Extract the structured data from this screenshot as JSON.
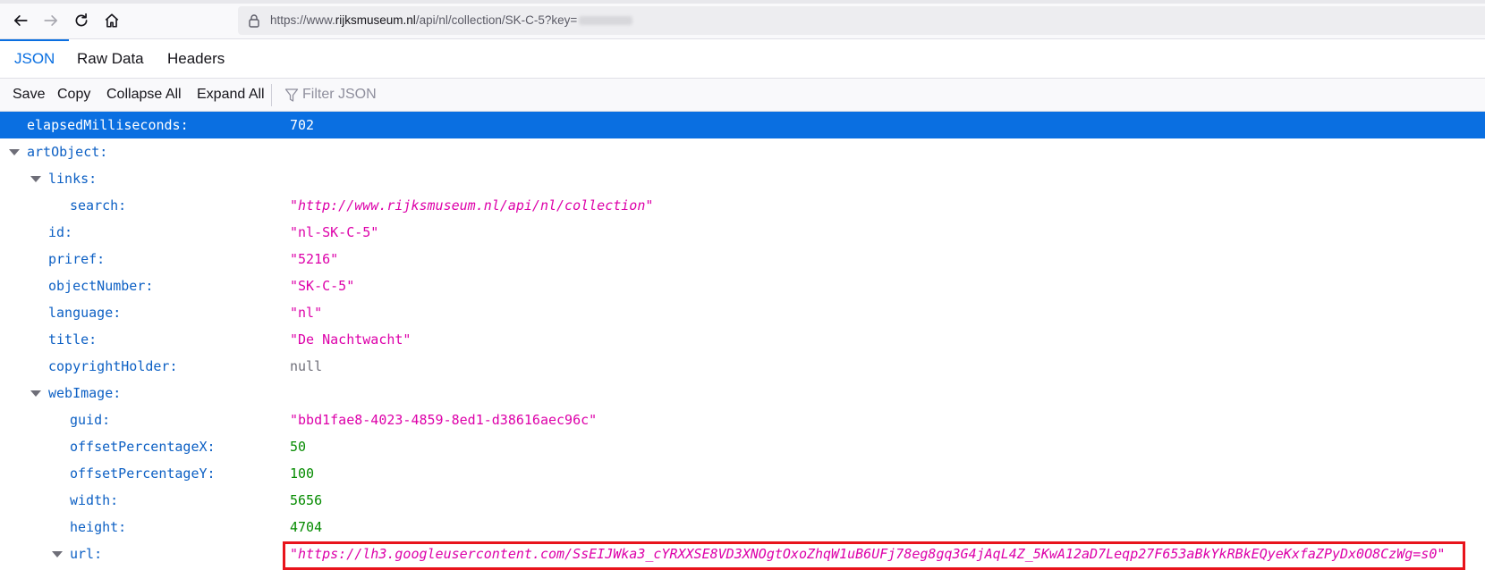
{
  "browser": {
    "url_prefix": "https://www.",
    "url_domain": "rijksmuseum.nl",
    "url_path": "/api/nl/collection/SK-C-5?key=",
    "url_key_obscured": "[blurred]"
  },
  "tabs": [
    {
      "label": "JSON",
      "active": true
    },
    {
      "label": "Raw Data",
      "active": false
    },
    {
      "label": "Headers",
      "active": false
    }
  ],
  "toolbar": {
    "save": "Save",
    "copy": "Copy",
    "collapse_all": "Collapse All",
    "expand_all": "Expand All",
    "filter_placeholder": "Filter JSON"
  },
  "rows": [
    {
      "key": "elapsedMilliseconds:",
      "value": "702",
      "type": "number",
      "selected": true
    },
    {
      "key": "artObject:",
      "value": "",
      "expanded": true
    },
    {
      "key": "links:",
      "value": "",
      "expanded": true
    },
    {
      "key": "search:",
      "value": "\"http://www.rijksmuseum.nl/api/nl/collection\"",
      "type": "url"
    },
    {
      "key": "id:",
      "value": "\"nl-SK-C-5\"",
      "type": "string"
    },
    {
      "key": "priref:",
      "value": "\"5216\"",
      "type": "string"
    },
    {
      "key": "objectNumber:",
      "value": "\"SK-C-5\"",
      "type": "string"
    },
    {
      "key": "language:",
      "value": "\"nl\"",
      "type": "string"
    },
    {
      "key": "title:",
      "value": "\"De Nachtwacht\"",
      "type": "string"
    },
    {
      "key": "copyrightHolder:",
      "value": "null",
      "type": "null"
    },
    {
      "key": "webImage:",
      "value": "",
      "expanded": true
    },
    {
      "key": "guid:",
      "value": "\"bbd1fae8-4023-4859-8ed1-d38616aec96c\"",
      "type": "string"
    },
    {
      "key": "offsetPercentageX:",
      "value": "50",
      "type": "number"
    },
    {
      "key": "offsetPercentageY:",
      "value": "100",
      "type": "number"
    },
    {
      "key": "width:",
      "value": "5656",
      "type": "number"
    },
    {
      "key": "height:",
      "value": "4704",
      "type": "number"
    },
    {
      "key": "url:",
      "value": "\"https://lh3.googleusercontent.com/SsEIJWka3_cYRXXSE8VD3XNOgtOxoZhqW1uB6UFj78eg8gq3G4jAqL4Z_5KwA12aD7Leqp27F653aBkYkRBkEQyeKxfaZPyDx0O8CzWg=s0\"",
      "type": "url",
      "highlighted": true
    }
  ],
  "colors": {
    "accent": "#0a6fe1",
    "key": "#0d60c4",
    "string": "#dd00a9",
    "number": "#058b00",
    "highlight_border": "#e8141c"
  }
}
